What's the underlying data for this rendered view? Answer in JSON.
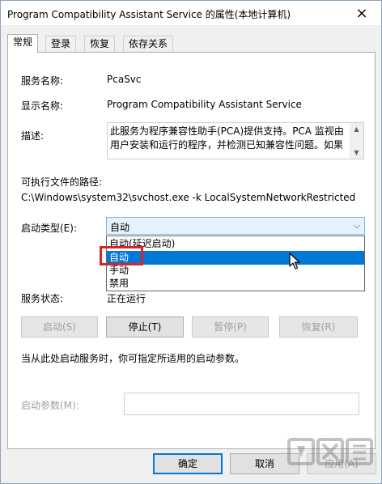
{
  "window": {
    "title": "Program Compatibility Assistant Service 的属性(本地计算机)",
    "close_icon": "×"
  },
  "tabs": [
    {
      "label": "常规",
      "active": true
    },
    {
      "label": "登录",
      "active": false
    },
    {
      "label": "恢复",
      "active": false
    },
    {
      "label": "依存关系",
      "active": false
    }
  ],
  "general": {
    "service_name_label": "服务名称:",
    "service_name_value": "PcaSvc",
    "display_name_label": "显示名称:",
    "display_name_value": "Program Compatibility Assistant Service",
    "description_label": "描述:",
    "description_value": "此服务为程序兼容性助手(PCA)提供支持。PCA 监视由用户安装和运行的程序，并检测已知兼容性问题。如果",
    "exe_path_label": "可执行文件的路径:",
    "exe_path_value": "C:\\Windows\\system32\\svchost.exe -k LocalSystemNetworkRestricted",
    "startup_type_label": "启动类型(E):",
    "startup_type_value": "自动",
    "startup_options": [
      "自动(延迟启动)",
      "自动",
      "手动",
      "禁用"
    ],
    "startup_selected_index": 1,
    "service_status_label": "服务状态:",
    "service_status_value": "正在运行"
  },
  "buttons": {
    "start": "启动(S)",
    "stop": "停止(T)",
    "pause": "暂停(P)",
    "resume": "恢复(R)"
  },
  "hint": "当从此处启动服务时，你可指定所适用的启动参数。",
  "start_params_label": "启动参数(M):",
  "dialog_buttons": {
    "ok": "确定",
    "cancel": "取消",
    "apply": "应用(A)"
  },
  "colors": {
    "accent": "#0078d7",
    "highlight_border": "#d9232a"
  }
}
